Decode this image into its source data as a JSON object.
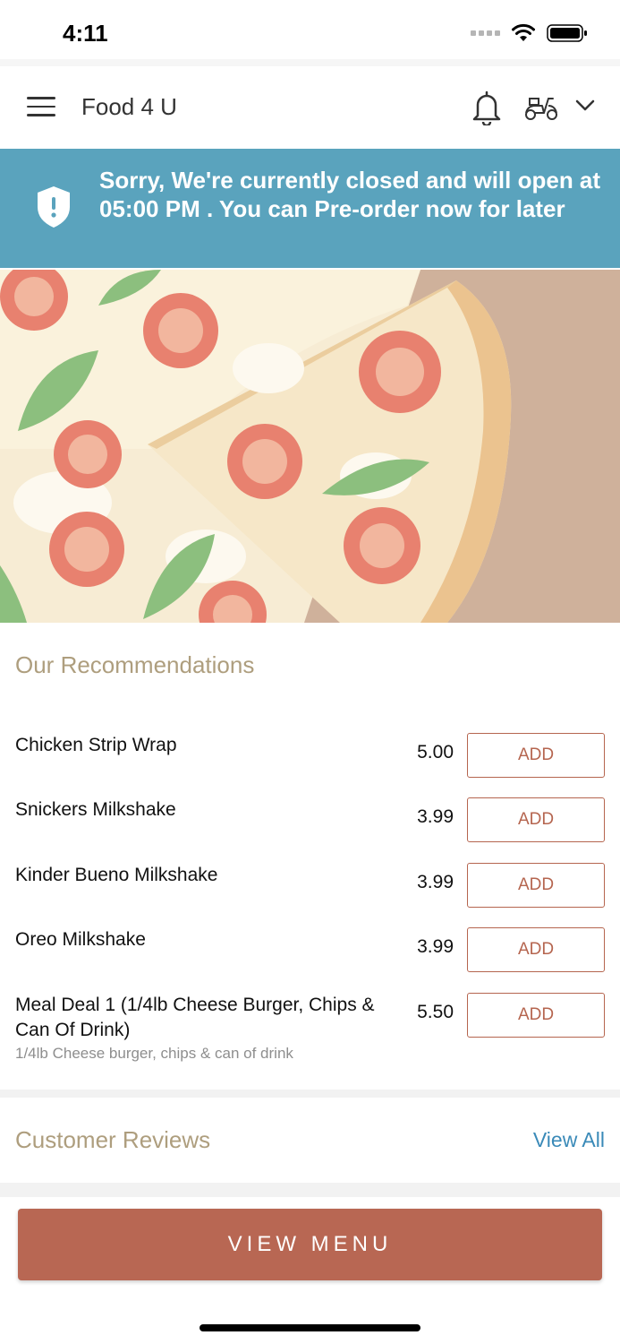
{
  "status_bar": {
    "time": "4:11"
  },
  "header": {
    "title": "Food 4 U"
  },
  "banner": {
    "text": "Sorry, We're currently closed and will open at 05:00 PM . You can Pre-order now for later"
  },
  "recommendations": {
    "title": "Our Recommendations",
    "items": [
      {
        "name": "Chicken Strip Wrap",
        "price": "5.00",
        "add_label": "ADD"
      },
      {
        "name": "Snickers Milkshake",
        "price": "3.99",
        "add_label": "ADD"
      },
      {
        "name": "Kinder Bueno Milkshake",
        "price": "3.99",
        "add_label": "ADD"
      },
      {
        "name": "Oreo Milkshake",
        "price": "3.99",
        "add_label": "ADD"
      },
      {
        "name": "Meal Deal 1 (1/4lb Cheese Burger, Chips & Can Of Drink)",
        "description": "1/4lb Cheese burger, chips & can of drink",
        "price": "5.50",
        "add_label": "ADD"
      }
    ]
  },
  "reviews": {
    "title": "Customer Reviews",
    "view_all": "View All"
  },
  "footer": {
    "button_label": "VIEW MENU"
  },
  "colors": {
    "banner": "#5aa3bd",
    "accent": "#b86753",
    "section_title": "#ae9e7e",
    "link": "#3a8ab8"
  },
  "icons": [
    "hamburger-menu-icon",
    "bell-icon",
    "scooter-icon",
    "chevron-down-icon",
    "shield-alert-icon",
    "signal-icon",
    "wifi-icon",
    "battery-icon"
  ]
}
